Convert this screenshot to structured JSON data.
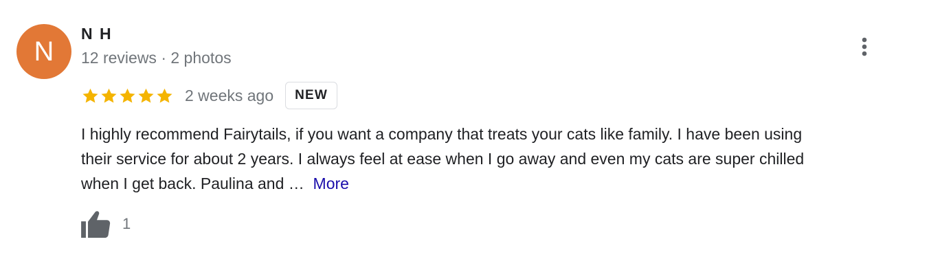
{
  "review": {
    "avatar_letter": "N",
    "avatar_color": "#e27836",
    "name": "N H",
    "meta": "12 reviews · 2 photos",
    "rating": 5,
    "rating_max": 5,
    "star_color": "#f4b400",
    "time": "2 weeks ago",
    "badge": "NEW",
    "text_line1": "I highly recommend Fairytails, if you want a company that treats your cats like family. I have been using",
    "text_line2": "their service for about 2 years. I always feel at ease when I go away and even my cats are super chilled",
    "text_line3": "when I get back. Paulina and …",
    "more_label": "More",
    "more_color": "#1a0dab",
    "like_count": "1",
    "menu_icon": "more-vert-icon",
    "like_icon": "thumbs-up-icon"
  }
}
